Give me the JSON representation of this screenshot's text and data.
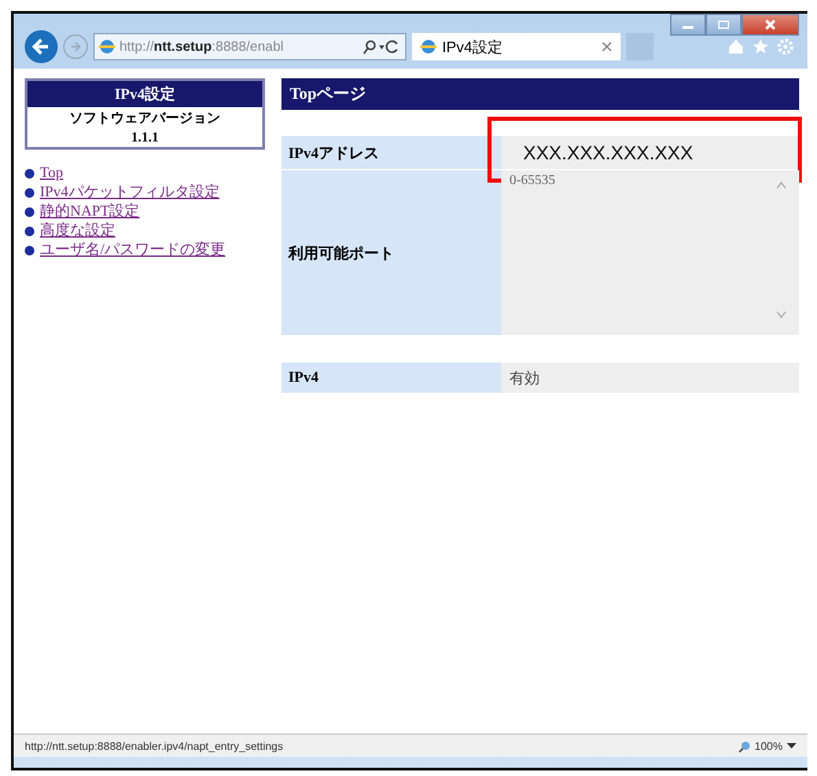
{
  "browser": {
    "address": "http://**ntt.setup**:8888/enabl",
    "tab_title": "IPv4設定"
  },
  "sidebar": {
    "title": "IPv4設定",
    "version_label": "ソフトウェアバージョン",
    "version": "1.1.1",
    "links": [
      {
        "label": "Top"
      },
      {
        "label": "IPv4パケットフィルタ設定"
      },
      {
        "label": "静的NAPT設定"
      },
      {
        "label": "高度な設定"
      },
      {
        "label": "ユーザ名/パスワードの変更"
      }
    ]
  },
  "main": {
    "heading": "Topページ",
    "table": [
      {
        "label": "IPv4アドレス",
        "value": "XXX.XXX.XXX.XXX",
        "kind": "text",
        "highlighted": true
      },
      {
        "label": "利用可能ポート",
        "value": "0-65535",
        "kind": "textarea",
        "highlighted": false
      }
    ],
    "status_table": [
      {
        "label": "IPv4",
        "value": "有効"
      }
    ]
  },
  "status_bar": {
    "url": "http://ntt.setup:8888/enabler.ipv4/napt_entry_settings",
    "zoom": "100%"
  }
}
